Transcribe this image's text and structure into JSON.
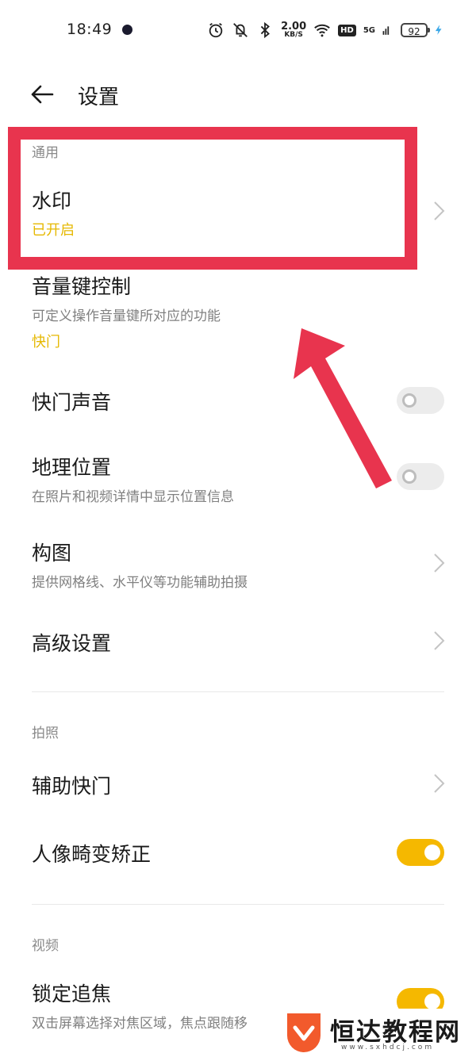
{
  "status_bar": {
    "time": "18:49",
    "net_speed_value": "2.00",
    "net_speed_unit": "KB/S",
    "hd": "HD",
    "network": "5G",
    "battery": "92"
  },
  "header": {
    "title": "设置"
  },
  "sections": {
    "general": "通用",
    "photo": "拍照",
    "video": "视频"
  },
  "rows": {
    "watermark": {
      "title": "水印",
      "status": "已开启"
    },
    "volume_key": {
      "title": "音量键控制",
      "subtitle": "可定义操作音量键所对应的功能",
      "status": "快门"
    },
    "shutter_sound": {
      "title": "快门声音",
      "enabled": false
    },
    "location": {
      "title": "地理位置",
      "subtitle": "在照片和视频详情中显示位置信息",
      "enabled": false
    },
    "composition": {
      "title": "构图",
      "subtitle": "提供网格线、水平仪等功能辅助拍摄"
    },
    "advanced": {
      "title": "高级设置"
    },
    "assist_shutter": {
      "title": "辅助快门"
    },
    "portrait_distortion": {
      "title": "人像畸变矫正",
      "enabled": true
    },
    "focus_lock": {
      "title": "锁定追焦",
      "subtitle": "双击屏幕选择对焦区域，焦点跟随移",
      "enabled": true
    }
  },
  "annotation": {
    "highlight_color": "#e8344e",
    "arrow_color": "#e8344e"
  },
  "watermark_overlay": {
    "name": "恒达教程网",
    "url": "www.sxhdcj.com"
  },
  "colors": {
    "accent": "#f5b800",
    "status_text": "#e6b800"
  }
}
